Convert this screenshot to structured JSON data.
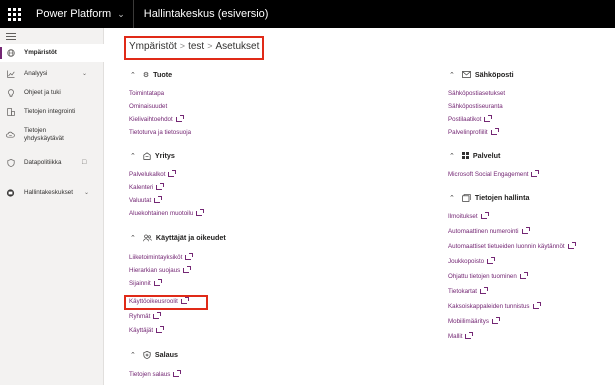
{
  "topbar": {
    "brand": "Power Platform",
    "app_title": "Hallintakeskus (esiversio)"
  },
  "sidebar": {
    "items": [
      {
        "label": "Ympäristöt",
        "icon": "globe-icon",
        "active": true
      },
      {
        "label": "Analyysi",
        "icon": "chart-line-icon",
        "chevron": true
      },
      {
        "label": "Ohjeet ja tuki",
        "icon": "lightbulb-icon"
      },
      {
        "label": "Tietojen integrointi",
        "icon": "data-integration-icon"
      },
      {
        "label": "Tietojen yhdyskäytävät",
        "icon": "cloud-gateway-icon"
      },
      {
        "label": "Datapolitiikka",
        "icon": "shield-icon",
        "external": true
      },
      {
        "label": "Hallintakeskukset",
        "icon": "admin-center-icon",
        "chevron": true
      }
    ]
  },
  "breadcrumb": {
    "items": [
      "Ympäristöt",
      "test",
      "Asetukset"
    ],
    "separator": ">"
  },
  "sections": {
    "tuote": {
      "title": "Tuote",
      "links": [
        "Toimintatapa",
        "Ominaisuudet",
        "Kielivaihtoehdot",
        "Tietoturva ja tietosuoja"
      ]
    },
    "yritys": {
      "title": "Yritys",
      "links": [
        "Palvelukalkot",
        "Kalenteri",
        "Valuutat",
        "Aluekohtainen muotoilu"
      ]
    },
    "kayttajat": {
      "title": "Käyttäjät ja oikeudet",
      "links": [
        "Liiketoimintayksiköt",
        "Hierarkian suojaus",
        "Sijainnit",
        "Käyttöoikeusroolit",
        "Ryhmät",
        "Käyttäjät"
      ]
    },
    "salaus": {
      "title": "Salaus",
      "links": [
        "Tietojen salaus"
      ]
    },
    "sahkoposti": {
      "title": "Sähköposti",
      "links": [
        "Sähköpostiasetukset",
        "Sähköpostiseuranta",
        "Postilaatikot",
        "Palvelinprofiilit"
      ]
    },
    "palvelut": {
      "title": "Palvelut",
      "links": [
        "Microsoft Social Engagement"
      ]
    },
    "tietojen_hallinta": {
      "title": "Tietojen hallinta",
      "links": [
        "Ilmoitukset",
        "Automaattinen numerointi",
        "Automaattiset tietueiden luonnin käytännöt",
        "Joukkopoisto",
        "Ohjattu tietojen tuominen",
        "Tietokartat",
        "Kaksoiskappaleiden tunnistus",
        "Mobiilimääritys",
        "Mallit"
      ]
    }
  },
  "colors": {
    "link": "#742774",
    "highlight": "#e02a18",
    "topbar": "#000000"
  }
}
